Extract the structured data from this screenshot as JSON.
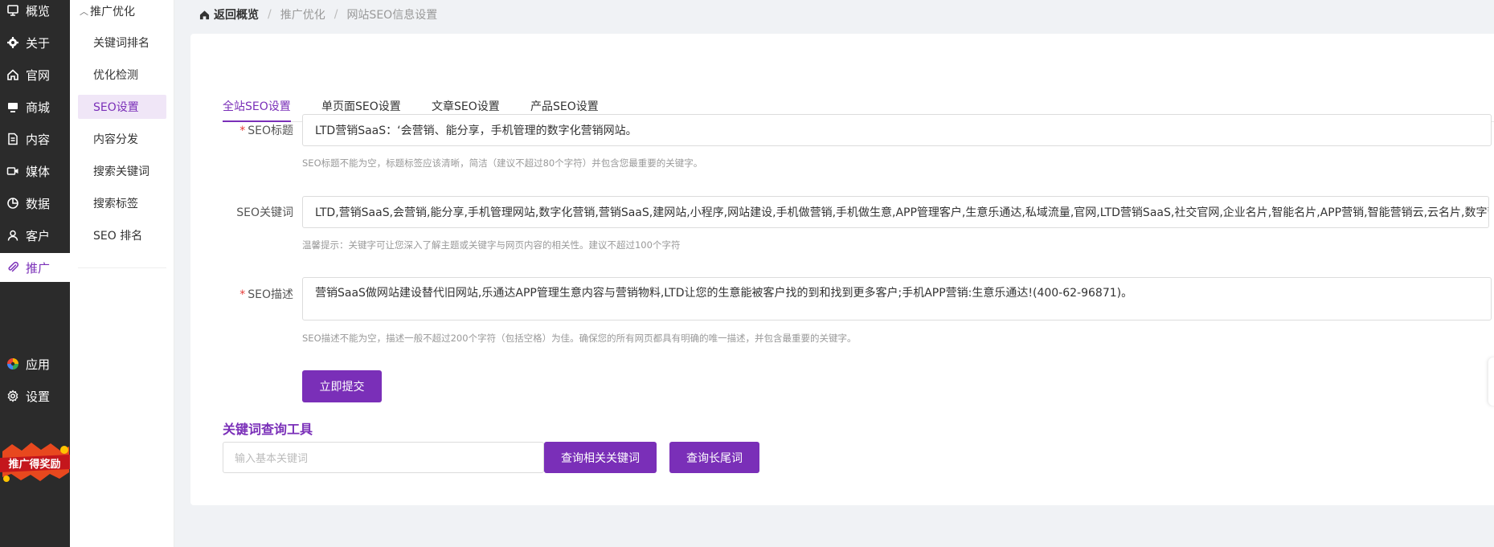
{
  "nav": {
    "items": [
      {
        "label": "概览",
        "icon": "dashboard-icon"
      },
      {
        "label": "关于",
        "icon": "gear-flower-icon"
      },
      {
        "label": "官网",
        "icon": "home-icon"
      },
      {
        "label": "商城",
        "icon": "store-icon"
      },
      {
        "label": "内容",
        "icon": "document-icon"
      },
      {
        "label": "媒体",
        "icon": "video-icon"
      },
      {
        "label": "数据",
        "icon": "pie-chart-icon"
      },
      {
        "label": "客户",
        "icon": "user-icon"
      },
      {
        "label": "推广",
        "icon": "paperclip-icon"
      },
      {
        "label": "应用",
        "icon": "apps-icon"
      },
      {
        "label": "设置",
        "icon": "settings-icon"
      }
    ],
    "promo_text": "推广得奖励"
  },
  "submenu": {
    "title": "推广优化",
    "items": [
      {
        "label": "关键词排名"
      },
      {
        "label": "优化检测"
      },
      {
        "label": "SEO设置"
      },
      {
        "label": "内容分发"
      },
      {
        "label": "搜索关键词"
      },
      {
        "label": "搜索标签"
      },
      {
        "label": "SEO 排名"
      }
    ]
  },
  "breadcrumb": {
    "home": "返回概览",
    "level1": "推广优化",
    "level2": "网站SEO信息设置"
  },
  "tabs": [
    "全站SEO设置",
    "单页面SEO设置",
    "文章SEO设置",
    "产品SEO设置"
  ],
  "form": {
    "title_label": "SEO标题",
    "title_value": "LTD营销SaaS：‘会营销、能分享，手机管理的数字化营销网站。",
    "title_hint": "SEO标题不能为空，标题标签应该清晰，简洁（建议不超过80个字符）并包含您最重要的关键字。",
    "keywords_label": "SEO关键词",
    "keywords_value": "LTD,营销SaaS,会营销,能分享,手机管理网站,数字化营销,营销SaaS,建网站,小程序,网站建设,手机做营销,手机做生意,APP管理客户,生意乐通达,私域流量,官网,LTD营销SaaS,社交官网,企业名片,智能名片,APP营销,智能营销云,云名片,数字营销",
    "keywords_hint": "温馨提示：关键字可让您深入了解主题或关键字与网页内容的相关性。建议不超过100个字符",
    "desc_label": "SEO描述",
    "desc_value": "营销SaaS做网站建设替代旧网站,乐通达APP管理生意内容与营销物料,LTD让您的生意能被客户找的到和找到更多客户;手机APP营销:生意乐通达!(400-62-96871)。",
    "desc_hint": "SEO描述不能为空，描述一般不超过200个字符（包括空格）为佳。确保您的所有网页都具有明确的唯一描述，并包含最重要的关键字。",
    "submit_label": "立即提交"
  },
  "keyword_tool": {
    "title": "关键词查询工具",
    "placeholder": "输入基本关键词",
    "related_button": "查询相关关键词",
    "longtail_button": "查询长尾词"
  },
  "colors": {
    "accent": "#7a2fb8",
    "nav_bg": "#2b2b2b",
    "required": "#e53935"
  }
}
